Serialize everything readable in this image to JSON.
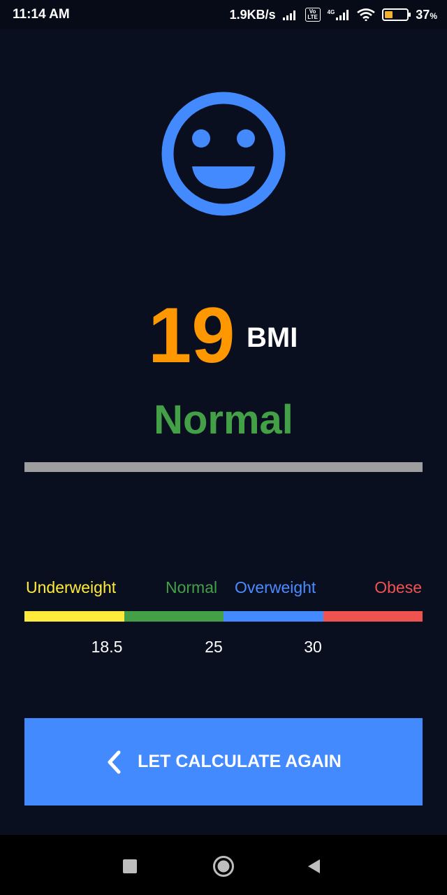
{
  "status_bar": {
    "time": "11:14 AM",
    "network_speed": "1.9KB/s",
    "battery_percent": "37",
    "battery_percent_sign": "%",
    "volte_badge": "Vo LTE",
    "network_type": "4G",
    "icons": [
      "signal-icon",
      "volte-icon",
      "4g-signal-icon",
      "wifi-icon",
      "battery-icon"
    ]
  },
  "result": {
    "face_icon": "smiley-face-icon",
    "face_color": "#448aff",
    "bmi_value": "19",
    "bmi_value_color": "#ff9800",
    "bmi_unit": "BMI",
    "category": "Normal",
    "category_color": "#43a047"
  },
  "scale": {
    "labels": [
      {
        "text": "Underweight",
        "color": "#ffeb3b"
      },
      {
        "text": "Normal",
        "color": "#43a047"
      },
      {
        "text": "Overweight",
        "color": "#4a8cff"
      },
      {
        "text": "Obese",
        "color": "#ef5350"
      }
    ],
    "segment_colors": [
      "#ffeb3b",
      "#43a047",
      "#448aff",
      "#ef5350"
    ],
    "ticks": [
      "18.5",
      "25",
      "30"
    ]
  },
  "action": {
    "button_label": "LET CALCULATE AGAIN",
    "button_icon": "chevron-left-icon",
    "button_color": "#448aff"
  },
  "nav_bar": {
    "icons": [
      "recent-apps-icon",
      "home-icon",
      "back-icon"
    ]
  }
}
